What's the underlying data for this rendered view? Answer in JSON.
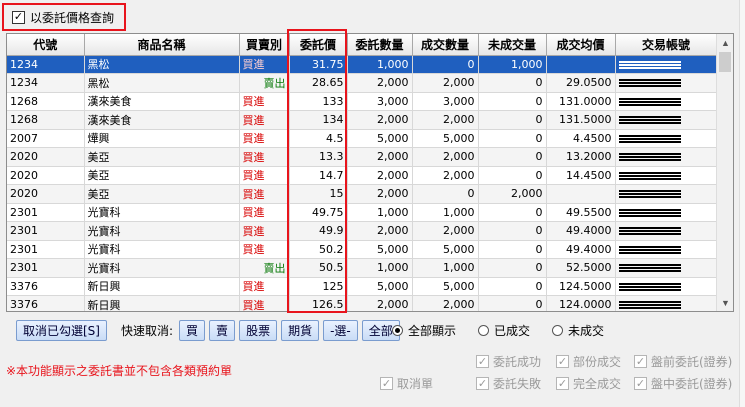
{
  "query_checkbox": {
    "label": "以委託價格查詢",
    "checked": true
  },
  "columns": [
    "代號",
    "商品名稱",
    "買賣別",
    "委託價",
    "委託數量",
    "成交數量",
    "未成交量",
    "成交均價",
    "交易帳號"
  ],
  "rows": [
    {
      "code": "1234",
      "name": "黑松",
      "side": "買進",
      "side_type": "buy",
      "price": "31.75",
      "qty": "1,000",
      "filled": "0",
      "unfilled": "1,000",
      "avg": ""
    },
    {
      "code": "1234",
      "name": "黑松",
      "side": "賣出",
      "side_type": "sell",
      "price": "28.65",
      "qty": "2,000",
      "filled": "2,000",
      "unfilled": "0",
      "avg": "29.0500"
    },
    {
      "code": "1268",
      "name": "漢來美食",
      "side": "買進",
      "side_type": "buy",
      "price": "133",
      "qty": "3,000",
      "filled": "3,000",
      "unfilled": "0",
      "avg": "131.0000"
    },
    {
      "code": "1268",
      "name": "漢來美食",
      "side": "買進",
      "side_type": "buy",
      "price": "134",
      "qty": "2,000",
      "filled": "2,000",
      "unfilled": "0",
      "avg": "131.5000"
    },
    {
      "code": "2007",
      "name": "燁興",
      "side": "買進",
      "side_type": "buy",
      "price": "4.5",
      "qty": "5,000",
      "filled": "5,000",
      "unfilled": "0",
      "avg": "4.4500"
    },
    {
      "code": "2020",
      "name": "美亞",
      "side": "買進",
      "side_type": "buy",
      "price": "13.3",
      "qty": "2,000",
      "filled": "2,000",
      "unfilled": "0",
      "avg": "13.2000"
    },
    {
      "code": "2020",
      "name": "美亞",
      "side": "買進",
      "side_type": "buy",
      "price": "14.7",
      "qty": "2,000",
      "filled": "2,000",
      "unfilled": "0",
      "avg": "14.4500"
    },
    {
      "code": "2020",
      "name": "美亞",
      "side": "買進",
      "side_type": "buy",
      "price": "15",
      "qty": "2,000",
      "filled": "0",
      "unfilled": "2,000",
      "avg": ""
    },
    {
      "code": "2301",
      "name": "光寶科",
      "side": "買進",
      "side_type": "buy",
      "price": "49.75",
      "qty": "1,000",
      "filled": "1,000",
      "unfilled": "0",
      "avg": "49.5500"
    },
    {
      "code": "2301",
      "name": "光寶科",
      "side": "買進",
      "side_type": "buy",
      "price": "49.9",
      "qty": "2,000",
      "filled": "2,000",
      "unfilled": "0",
      "avg": "49.4000"
    },
    {
      "code": "2301",
      "name": "光寶科",
      "side": "買進",
      "side_type": "buy",
      "price": "50.2",
      "qty": "5,000",
      "filled": "5,000",
      "unfilled": "0",
      "avg": "49.4000"
    },
    {
      "code": "2301",
      "name": "光寶科",
      "side": "賣出",
      "side_type": "sell",
      "price": "50.5",
      "qty": "1,000",
      "filled": "1,000",
      "unfilled": "0",
      "avg": "52.5000"
    },
    {
      "code": "3376",
      "name": "新日興",
      "side": "買進",
      "side_type": "buy",
      "price": "125",
      "qty": "5,000",
      "filled": "5,000",
      "unfilled": "0",
      "avg": "124.5000"
    },
    {
      "code": "3376",
      "name": "新日興",
      "side": "買進",
      "side_type": "buy",
      "price": "126.5",
      "qty": "2,000",
      "filled": "2,000",
      "unfilled": "0",
      "avg": "124.0000"
    },
    {
      "code": "3376",
      "name": "新日興",
      "side": "買進",
      "side_type": "buy",
      "price": "127",
      "qty": "2,000",
      "filled": "2,000",
      "unfilled": "0",
      "avg": "124.0000"
    }
  ],
  "toolbar": {
    "cancel_selected": "取消已勾選[S]",
    "quick_cancel_label": "快速取消:",
    "quick_buttons": [
      "買",
      "賣",
      "股票",
      "期貨",
      "-選-",
      "全部"
    ]
  },
  "display_radios": [
    "全部顯示",
    "已成交",
    "未成交"
  ],
  "note": "※本功能顯示之委託書並不包含各類預約單",
  "filters_row1": [
    "委託成功",
    "部份成交",
    "盤前委託(證券)"
  ],
  "filters_row2": [
    "取消單",
    "委託失敗",
    "完全成交",
    "盤中委託(證券)"
  ],
  "colors": {
    "highlight_red": "#e8141c",
    "selected_blue": "#1f5fbf",
    "buy_red": "#d80000",
    "sell_green": "#0a7a0a"
  }
}
